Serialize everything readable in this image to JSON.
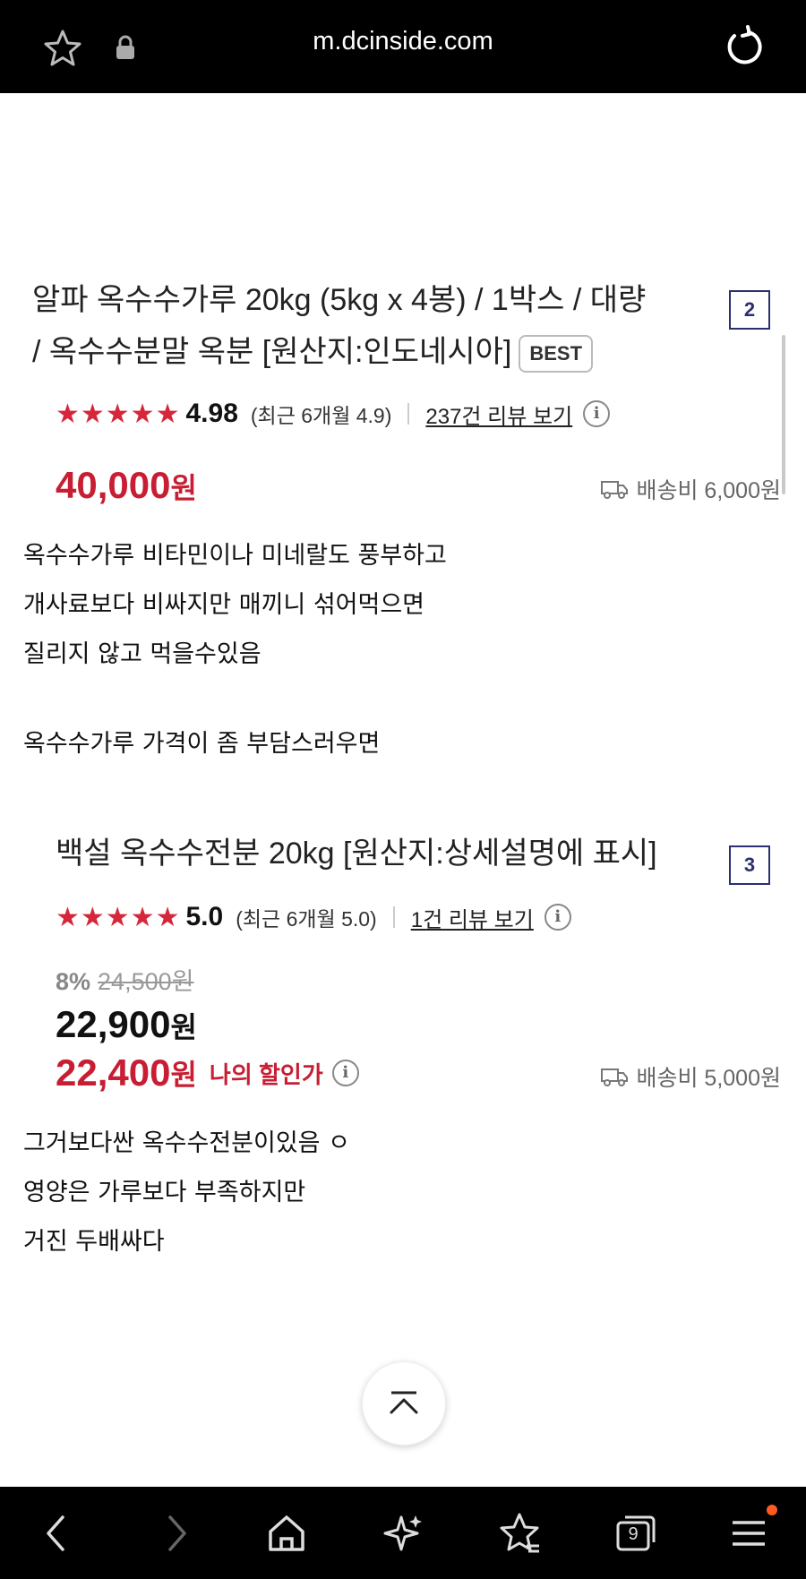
{
  "browser": {
    "url": "m.dcinside.com",
    "tab_count": "9"
  },
  "product1": {
    "number": "2",
    "title_line1": "알파 옥수수가루 20kg (5kg x 4봉) / 1박스 / 대량",
    "title_line2": "/ 옥수수분말 옥분 [원산지:인도네시아]",
    "badge": "BEST",
    "stars": "★★★★★",
    "score": "4.98",
    "recent": "(최근 6개월 4.9)",
    "reviews": "237건 리뷰 보기",
    "price": "40,000",
    "won": "원",
    "shipping": "배송비 6,000원"
  },
  "text1": {
    "lines": [
      "옥수수가루 비타민이나 미네랄도 풍부하고",
      "개사료보다 비싸지만 매끼니 섞어먹으면",
      "질리지 않고 먹을수있음",
      "옥수수가루 가격이 좀 부담스러우면"
    ]
  },
  "product2": {
    "number": "3",
    "title": "백설 옥수수전분 20kg [원산지:상세설명에 표시]",
    "stars": "★★★★★",
    "score": "5.0",
    "recent": "(최근 6개월 5.0)",
    "reviews": "1건 리뷰 보기",
    "discount_pct": "8%",
    "original_price": "24,500원",
    "price": "22,900",
    "my_price": "22,400",
    "won": "원",
    "my_discount_label": "나의 할인가",
    "shipping": "배송비 5,000원"
  },
  "text2": {
    "lines": [
      "그거보다싼 옥수수전분이있음 ㅇ",
      "영양은 가루보다 부족하지만",
      "거진 두배싸다"
    ]
  }
}
